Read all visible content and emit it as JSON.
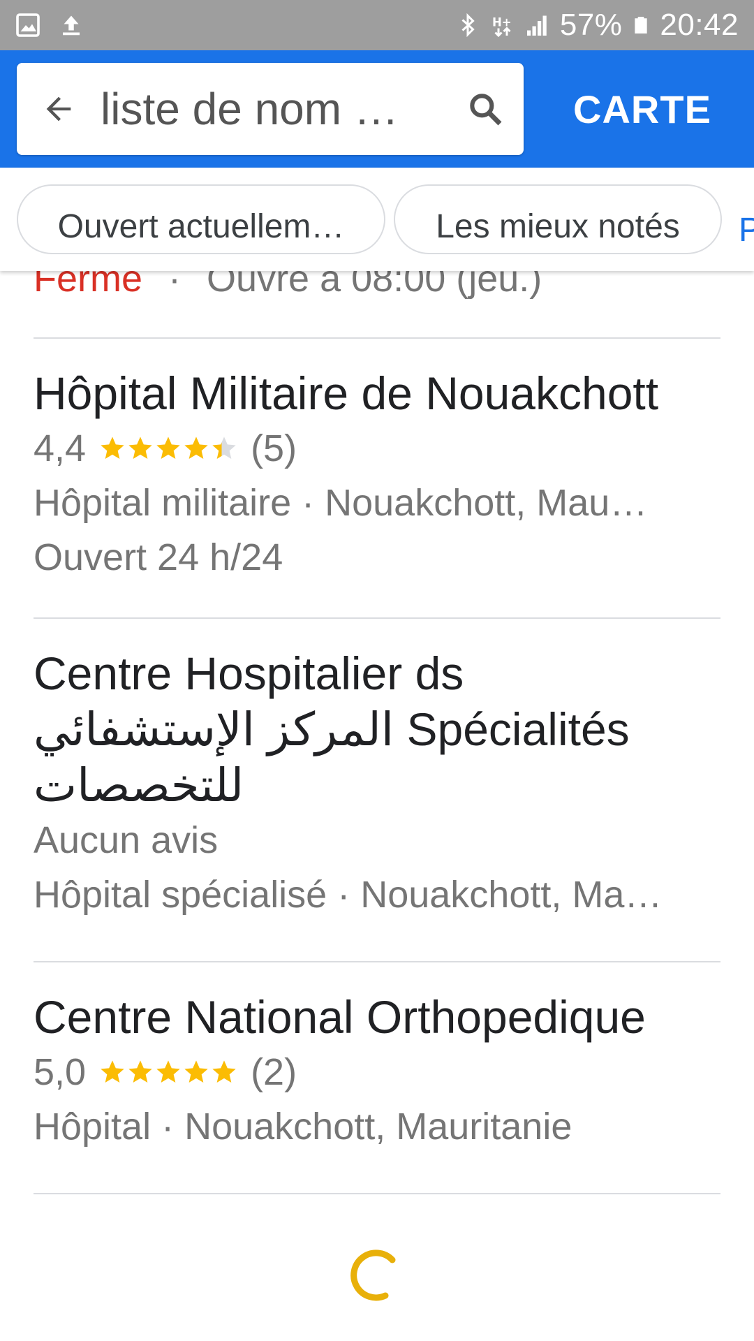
{
  "status_bar": {
    "battery": "57%",
    "time": "20:42",
    "left_icons": [
      "image-icon",
      "upload-icon"
    ],
    "right_icons": [
      "bluetooth-icon",
      "network-h-plus-icon",
      "signal-icon",
      "battery-icon"
    ]
  },
  "search": {
    "query": "liste de nom …",
    "back_icon": "arrow-back-icon",
    "search_icon": "search-icon",
    "map_button": "CARTE"
  },
  "filters": {
    "chips": [
      "Ouvert actuellem…",
      "Les mieux notés"
    ],
    "more_partial": "P"
  },
  "previous_item": {
    "status": "Fermé",
    "separator": "·",
    "opens": "Ouvre à 08:00 (jeu.)"
  },
  "results": [
    {
      "name": "Hôpital Militaire de Nouakchott",
      "rating": "4,4",
      "rating_value": 4.4,
      "reviews": "(5)",
      "category_location": "Hôpital militaire · Nouakchott, Mau…",
      "hours": "Ouvert 24 h/24"
    },
    {
      "name_line1": "Centre Hospitalier ds",
      "name_line2": "المركز الإستشفائي Spécialités",
      "name_line3": "للتخصصات",
      "reviews_text": "Aucun avis",
      "category_location": "Hôpital spécialisé · Nouakchott, Ma…"
    },
    {
      "name": "Centre National Orthopedique",
      "rating": "5,0",
      "rating_value": 5.0,
      "reviews": "(2)",
      "category_location": "Hôpital · Nouakchott, Mauritanie"
    }
  ],
  "colors": {
    "app_bar": "#1a73e8",
    "status_bar": "#9e9e9e",
    "star": "#fbbc04",
    "closed": "#d93025",
    "spinner": "#e8b00a"
  },
  "loading_icon": "loading-spinner-icon"
}
